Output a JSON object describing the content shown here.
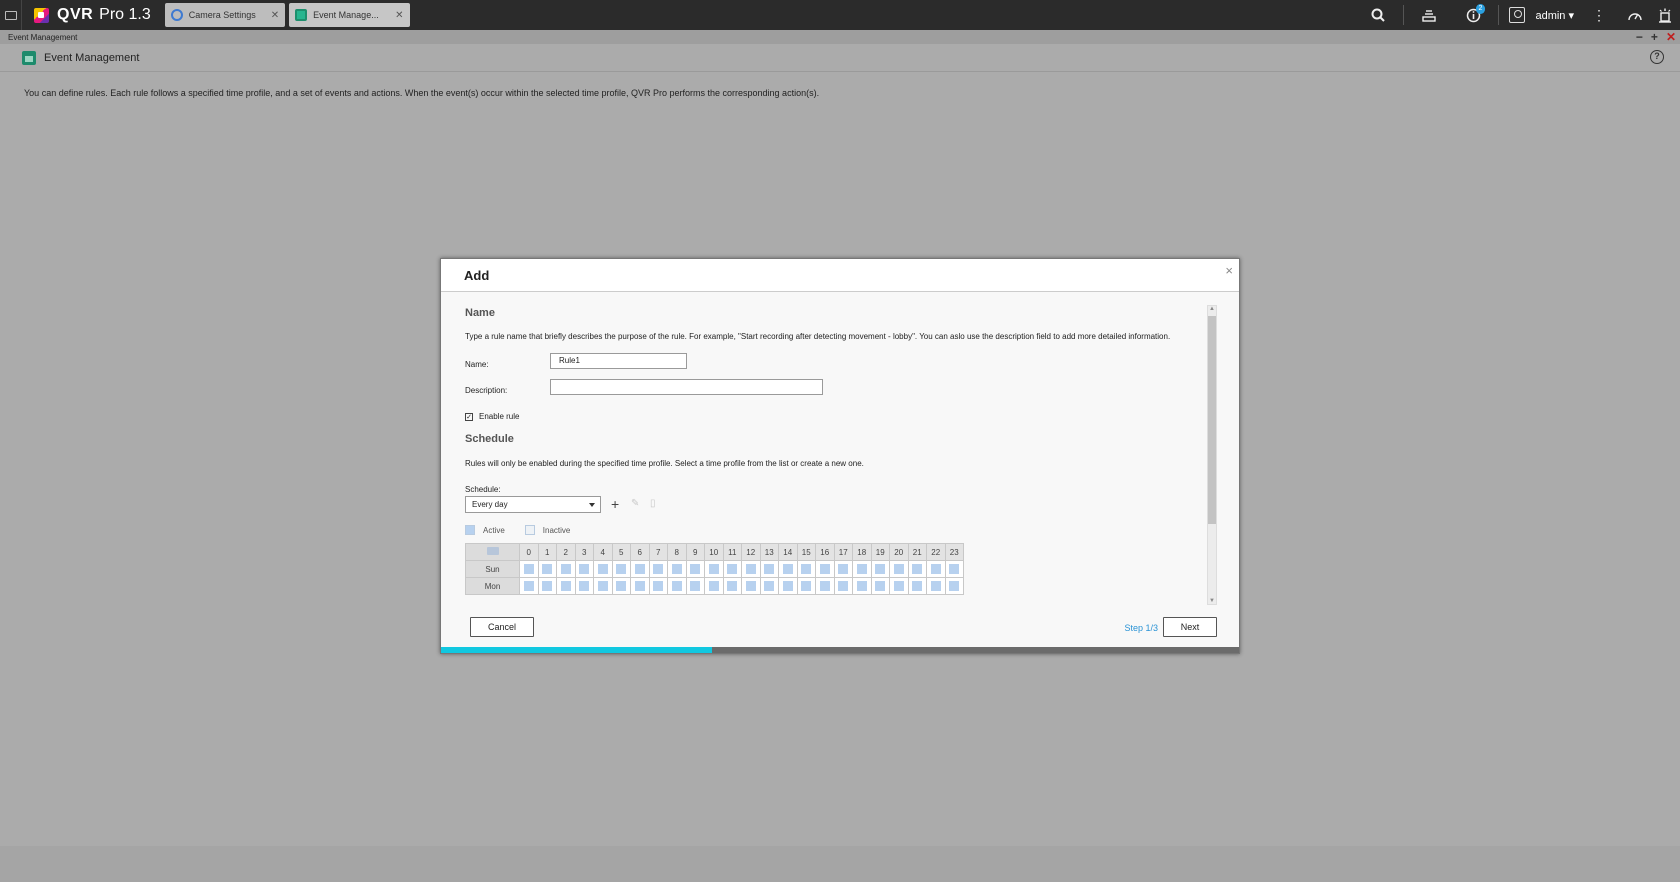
{
  "topbar": {
    "app_name": "QVR",
    "app_version": "Pro 1.3",
    "tabs": [
      {
        "label": "Camera Settings",
        "icon": "camera-settings-icon"
      },
      {
        "label": "Event Manage...",
        "icon": "event-management-icon"
      }
    ],
    "notification_count": "2",
    "user": "admin"
  },
  "window": {
    "title": "Event Management",
    "controls": {
      "minimize": "−",
      "maximize": "+",
      "close": "✕"
    }
  },
  "app": {
    "header_title": "Event Management",
    "intro": "You can define rules. Each rule follows a specified time profile, and a set of events and actions. When the event(s) occur within the selected time profile, QVR Pro performs the corresponding action(s)."
  },
  "dialog": {
    "title": "Add",
    "close": "×",
    "name_section": {
      "title": "Name",
      "description": "Type a rule name that briefly describes the purpose of the rule. For example, \"Start recording after detecting movement - lobby\". You can aslo use the description field to add more detailed information.",
      "name_label": "Name:",
      "name_value": "Rule1",
      "description_label": "Description:",
      "description_value": "",
      "enable_label": "Enable rule",
      "enable_checked": true
    },
    "schedule_section": {
      "title": "Schedule",
      "description": "Rules will only be enabled during the specified time profile. Select a time profile from the list or create a new one.",
      "schedule_label": "Schedule:",
      "selected": "Every day",
      "legend_active": "Active",
      "legend_inactive": "Inactive",
      "hours": [
        "0",
        "1",
        "2",
        "3",
        "4",
        "5",
        "6",
        "7",
        "8",
        "9",
        "10",
        "11",
        "12",
        "13",
        "14",
        "15",
        "16",
        "17",
        "18",
        "19",
        "20",
        "21",
        "22",
        "23"
      ],
      "days": [
        "Sun",
        "Mon"
      ]
    },
    "footer": {
      "cancel": "Cancel",
      "step": "Step 1/3",
      "next": "Next",
      "progress": 0.34
    }
  },
  "colors": {
    "accent": "#11c8e0",
    "step_text": "#2a93d5",
    "active_cell": "#b7d1ef",
    "topbar_bg": "#2b2b2b"
  }
}
